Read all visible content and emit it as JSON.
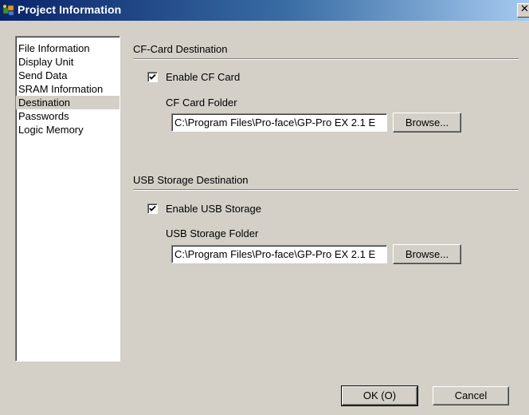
{
  "window": {
    "title": "Project Information",
    "close_glyph": "✕",
    "icon": "project-icon"
  },
  "nav": {
    "items": [
      {
        "label": "File Information",
        "selected": false
      },
      {
        "label": "Display Unit",
        "selected": false
      },
      {
        "label": "Send Data",
        "selected": false
      },
      {
        "label": "SRAM Information",
        "selected": false
      },
      {
        "label": "Destination",
        "selected": true
      },
      {
        "label": "Passwords",
        "selected": false
      },
      {
        "label": "Logic Memory",
        "selected": false
      }
    ]
  },
  "cf": {
    "section_label": "CF-Card Destination",
    "enable_label": "Enable CF Card",
    "enable_checked": true,
    "folder_label": "CF Card Folder",
    "folder_value": "C:\\Program Files\\Pro-face\\GP-Pro EX 2.1 E",
    "browse_label": "Browse..."
  },
  "usb": {
    "section_label": "USB Storage Destination",
    "enable_label": "Enable USB Storage",
    "enable_checked": true,
    "folder_label": "USB Storage Folder",
    "folder_value": "C:\\Program Files\\Pro-face\\GP-Pro EX 2.1 E",
    "browse_label": "Browse..."
  },
  "footer": {
    "ok_label": "OK (O)",
    "cancel_label": "Cancel"
  },
  "colors": {
    "face": "#d4d0c8",
    "title_start": "#0a246a",
    "title_end": "#a6caf0"
  }
}
